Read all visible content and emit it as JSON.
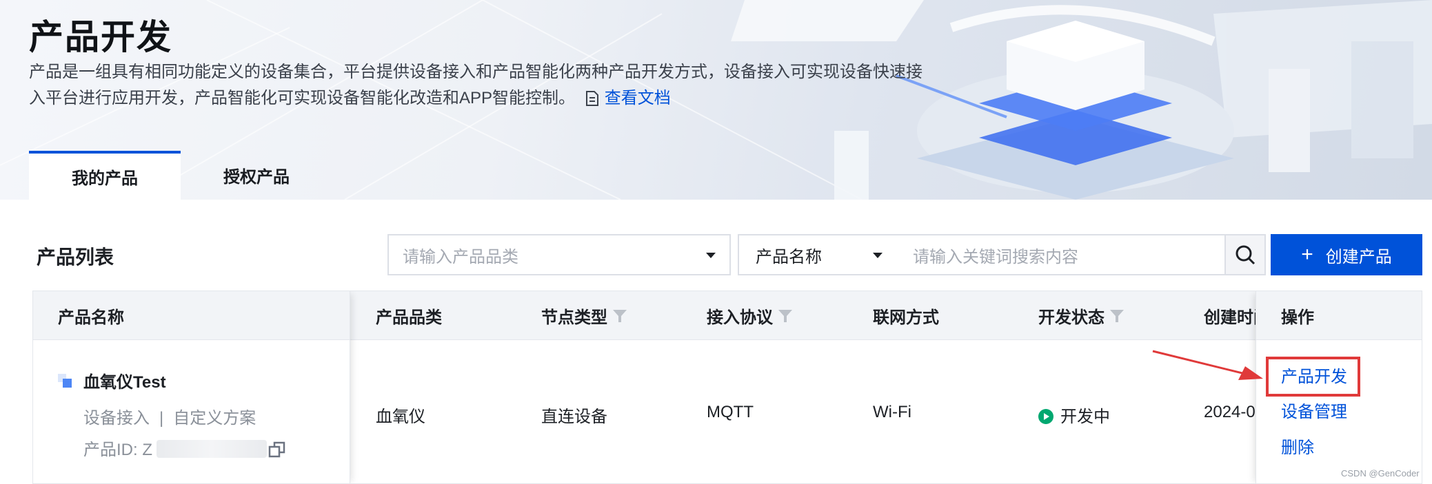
{
  "page": {
    "title": "产品开发",
    "description": "产品是一组具有相同功能定义的设备集合，平台提供设备接入和产品智能化两种产品开发方式，设备接入可实现设备快速接入平台进行应用开发，产品智能化可实现设备智能化改造和APP智能控制。",
    "doc_link": "查看文档"
  },
  "tabs": [
    {
      "label": "我的产品",
      "active": true
    },
    {
      "label": "授权产品",
      "active": false
    }
  ],
  "toolbar": {
    "list_title": "产品列表",
    "category_placeholder": "请输入产品品类",
    "search_field": "产品名称",
    "search_placeholder": "请输入关键词搜索内容",
    "create_label": "创建产品"
  },
  "table": {
    "columns": {
      "name": "产品名称",
      "category": "产品品类",
      "node_type": "节点类型",
      "protocol": "接入协议",
      "network": "联网方式",
      "dev_status": "开发状态",
      "created": "创建时间",
      "actions": "操作"
    },
    "rows": [
      {
        "name": "血氧仪Test",
        "access": "设备接入",
        "scheme": "自定义方案",
        "id_label": "产品ID:",
        "id_value": "Z",
        "category": "血氧仪",
        "node_type": "直连设备",
        "protocol": "MQTT",
        "network": "Wi-Fi",
        "dev_status": "开发中",
        "created": "2024-0",
        "actions": [
          "产品开发",
          "设备管理",
          "删除"
        ]
      }
    ]
  },
  "watermark": "CSDN @GenCoder",
  "colors": {
    "primary": "#0052d9",
    "status_green": "#00a870",
    "annotation_red": "#e03a3a"
  }
}
